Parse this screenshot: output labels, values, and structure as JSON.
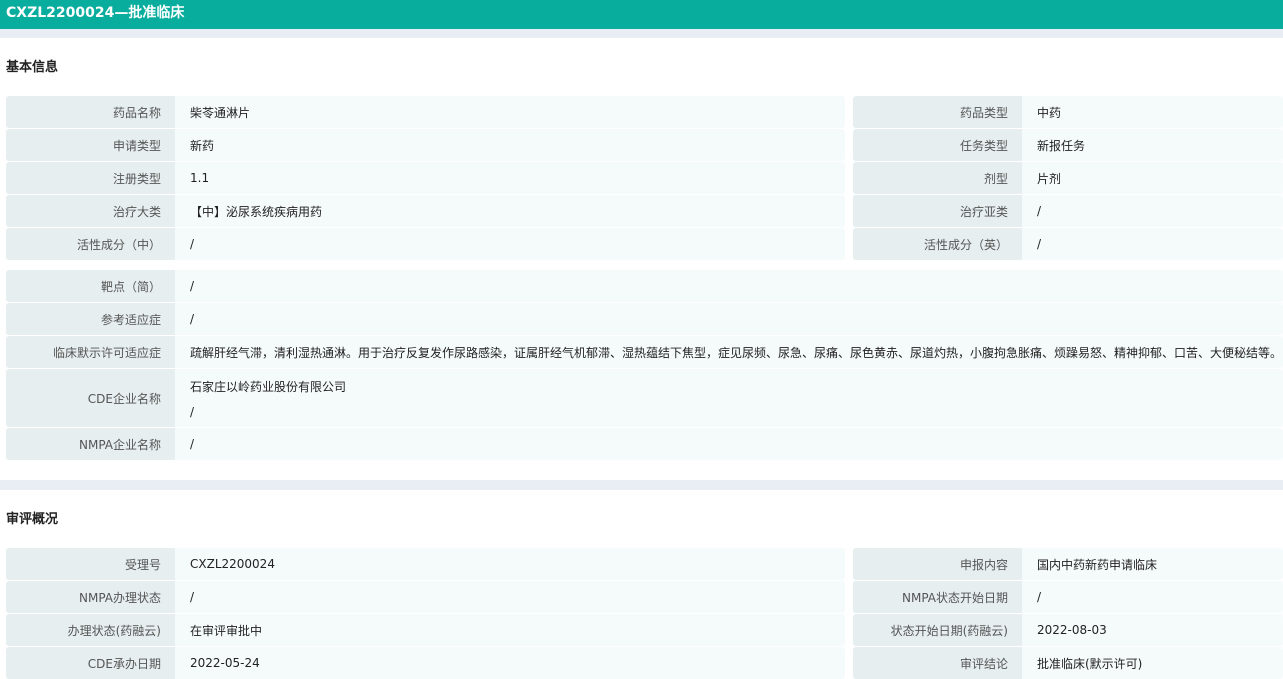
{
  "title": "CXZL2200024—批准临床",
  "basic": {
    "title": "基本信息",
    "pairs": [
      [
        {
          "label": "药品名称",
          "value": "柴苓通淋片"
        },
        {
          "label": "药品类型",
          "value": "中药"
        }
      ],
      [
        {
          "label": "申请类型",
          "value": "新药"
        },
        {
          "label": "任务类型",
          "value": "新报任务"
        }
      ],
      [
        {
          "label": "注册类型",
          "value": "1.1"
        },
        {
          "label": "剂型",
          "value": "片剂"
        }
      ],
      [
        {
          "label": "治疗大类",
          "value": "【中】泌尿系统疾病用药"
        },
        {
          "label": "治疗亚类",
          "value": "/"
        }
      ],
      [
        {
          "label": "活性成分（中）",
          "value": "/"
        },
        {
          "label": "活性成分（英）",
          "value": "/"
        }
      ]
    ],
    "full": [
      {
        "label": "靶点（简）",
        "value": "/"
      },
      {
        "label": "参考适应症",
        "value": "/"
      },
      {
        "label": "临床默示许可适应症",
        "value": "疏解肝经气滞，清利湿热通淋。用于治疗反复发作尿路感染，证属肝经气机郁滞、湿热蕴结下焦型，症见尿频、尿急、尿痛、尿色黄赤、尿道灼热，小腹拘急胀痛、烦躁易怒、精神抑郁、口苦、大便秘结等。"
      },
      {
        "label": "CDE企业名称",
        "value": "石家庄以岭药业股份有限公司",
        "value2": "/"
      },
      {
        "label": "NMPA企业名称",
        "value": "/"
      }
    ]
  },
  "review": {
    "title": "审评概况",
    "pairs": [
      [
        {
          "label": "受理号",
          "value": "CXZL2200024"
        },
        {
          "label": "申报内容",
          "value": "国内中药新药申请临床"
        }
      ],
      [
        {
          "label": "NMPA办理状态",
          "value": "/"
        },
        {
          "label": "NMPA状态开始日期",
          "value": "/"
        }
      ],
      [
        {
          "label": "办理状态(药融云)",
          "value": "在审评审批中"
        },
        {
          "label": "状态开始日期(药融云)",
          "value": "2022-08-03"
        }
      ],
      [
        {
          "label": "CDE承办日期",
          "value": "2022-05-24"
        },
        {
          "label": "审评结论",
          "value": "批准临床(默示许可)"
        }
      ]
    ]
  }
}
